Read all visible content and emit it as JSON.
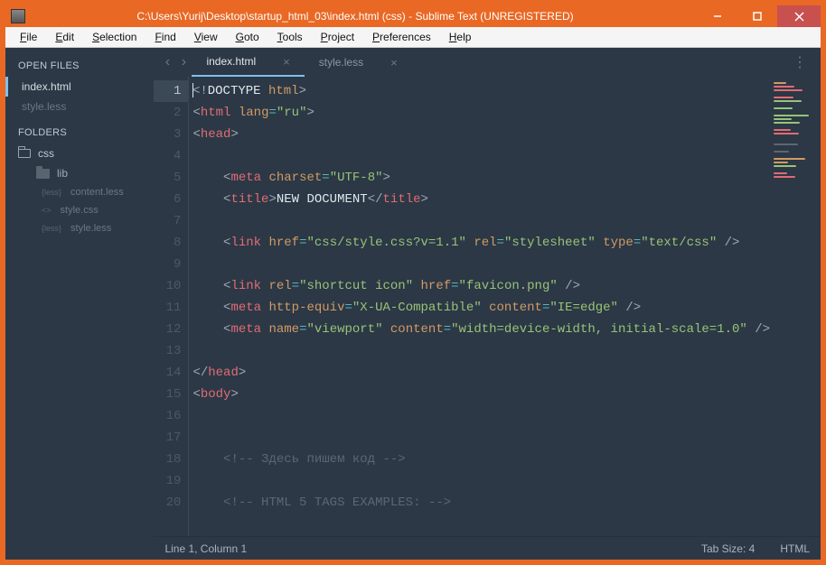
{
  "window": {
    "title": "C:\\Users\\Yurij\\Desktop\\startup_html_03\\index.html (css) - Sublime Text (UNREGISTERED)"
  },
  "menu": [
    "File",
    "Edit",
    "Selection",
    "Find",
    "View",
    "Goto",
    "Tools",
    "Project",
    "Preferences",
    "Help"
  ],
  "sidebar": {
    "openFilesHeader": "OPEN FILES",
    "openFiles": [
      {
        "label": "index.html",
        "active": true
      },
      {
        "label": "style.less",
        "active": false
      }
    ],
    "foldersHeader": "FOLDERS",
    "rootFolder": "css",
    "subFolder": "lib",
    "subFiles": [
      {
        "prefix": "{less}",
        "label": "content.less"
      },
      {
        "prefix": "<>",
        "label": "style.css"
      },
      {
        "prefix": "{less}",
        "label": "style.less"
      }
    ]
  },
  "tabs": [
    {
      "label": "index.html",
      "active": true
    },
    {
      "label": "style.less",
      "active": false
    }
  ],
  "code": {
    "lines": [
      {
        "n": 1,
        "active": true,
        "tokens": [
          {
            "t": "caret"
          },
          {
            "t": "brk",
            "s": "<!"
          },
          {
            "t": "sp",
            "s": "DOCTYPE "
          },
          {
            "t": "attr",
            "s": "html"
          },
          {
            "t": "brk",
            "s": ">"
          }
        ]
      },
      {
        "n": 2,
        "tokens": [
          {
            "t": "brk",
            "s": "<"
          },
          {
            "t": "tag",
            "s": "html"
          },
          {
            "t": "sp",
            "s": " "
          },
          {
            "t": "attr",
            "s": "lang"
          },
          {
            "t": "op",
            "s": "="
          },
          {
            "t": "str",
            "s": "\"ru\""
          },
          {
            "t": "brk",
            "s": ">"
          }
        ]
      },
      {
        "n": 3,
        "tokens": [
          {
            "t": "brk",
            "s": "<"
          },
          {
            "t": "tag",
            "s": "head"
          },
          {
            "t": "brk",
            "s": ">"
          }
        ]
      },
      {
        "n": 4,
        "tokens": []
      },
      {
        "n": 5,
        "tokens": [
          {
            "t": "sp",
            "s": "    "
          },
          {
            "t": "brk",
            "s": "<"
          },
          {
            "t": "tag",
            "s": "meta"
          },
          {
            "t": "sp",
            "s": " "
          },
          {
            "t": "attr",
            "s": "charset"
          },
          {
            "t": "op",
            "s": "="
          },
          {
            "t": "str",
            "s": "\"UTF-8\""
          },
          {
            "t": "brk",
            "s": ">"
          }
        ]
      },
      {
        "n": 6,
        "tokens": [
          {
            "t": "sp",
            "s": "    "
          },
          {
            "t": "brk",
            "s": "<"
          },
          {
            "t": "tag",
            "s": "title"
          },
          {
            "t": "brk",
            "s": ">"
          },
          {
            "t": "txt",
            "s": "NEW DOCUMENT"
          },
          {
            "t": "brk",
            "s": "</"
          },
          {
            "t": "tag",
            "s": "title"
          },
          {
            "t": "brk",
            "s": ">"
          }
        ]
      },
      {
        "n": 7,
        "tokens": []
      },
      {
        "n": 8,
        "tokens": [
          {
            "t": "sp",
            "s": "    "
          },
          {
            "t": "brk",
            "s": "<"
          },
          {
            "t": "tag",
            "s": "link"
          },
          {
            "t": "sp",
            "s": " "
          },
          {
            "t": "attr",
            "s": "href"
          },
          {
            "t": "op",
            "s": "="
          },
          {
            "t": "str",
            "s": "\"css/style.css?v=1.1\""
          },
          {
            "t": "sp",
            "s": " "
          },
          {
            "t": "attr",
            "s": "rel"
          },
          {
            "t": "op",
            "s": "="
          },
          {
            "t": "str",
            "s": "\"stylesheet\""
          },
          {
            "t": "sp",
            "s": " "
          },
          {
            "t": "attr",
            "s": "type"
          },
          {
            "t": "op",
            "s": "="
          },
          {
            "t": "str",
            "s": "\"text/css\""
          },
          {
            "t": "sp",
            "s": " "
          },
          {
            "t": "brk",
            "s": "/>"
          }
        ]
      },
      {
        "n": 9,
        "tokens": []
      },
      {
        "n": 10,
        "tokens": [
          {
            "t": "sp",
            "s": "    "
          },
          {
            "t": "brk",
            "s": "<"
          },
          {
            "t": "tag",
            "s": "link"
          },
          {
            "t": "sp",
            "s": " "
          },
          {
            "t": "attr",
            "s": "rel"
          },
          {
            "t": "op",
            "s": "="
          },
          {
            "t": "str",
            "s": "\"shortcut icon\""
          },
          {
            "t": "sp",
            "s": " "
          },
          {
            "t": "attr",
            "s": "href"
          },
          {
            "t": "op",
            "s": "="
          },
          {
            "t": "str",
            "s": "\"favicon.png\""
          },
          {
            "t": "sp",
            "s": " "
          },
          {
            "t": "brk",
            "s": "/>"
          }
        ]
      },
      {
        "n": 11,
        "tokens": [
          {
            "t": "sp",
            "s": "    "
          },
          {
            "t": "brk",
            "s": "<"
          },
          {
            "t": "tag",
            "s": "meta"
          },
          {
            "t": "sp",
            "s": " "
          },
          {
            "t": "attr",
            "s": "http-equiv"
          },
          {
            "t": "op",
            "s": "="
          },
          {
            "t": "str",
            "s": "\"X-UA-Compatible\""
          },
          {
            "t": "sp",
            "s": " "
          },
          {
            "t": "attr",
            "s": "content"
          },
          {
            "t": "op",
            "s": "="
          },
          {
            "t": "str",
            "s": "\"IE=edge\""
          },
          {
            "t": "sp",
            "s": " "
          },
          {
            "t": "brk",
            "s": "/>"
          }
        ]
      },
      {
        "n": 12,
        "tokens": [
          {
            "t": "sp",
            "s": "    "
          },
          {
            "t": "brk",
            "s": "<"
          },
          {
            "t": "tag",
            "s": "meta"
          },
          {
            "t": "sp",
            "s": " "
          },
          {
            "t": "attr",
            "s": "name"
          },
          {
            "t": "op",
            "s": "="
          },
          {
            "t": "str",
            "s": "\"viewport\""
          },
          {
            "t": "sp",
            "s": " "
          },
          {
            "t": "attr",
            "s": "content"
          },
          {
            "t": "op",
            "s": "="
          },
          {
            "t": "str",
            "s": "\"width=device-width, initial-scale=1.0\""
          },
          {
            "t": "sp",
            "s": " "
          },
          {
            "t": "brk",
            "s": "/>"
          }
        ]
      },
      {
        "n": 13,
        "tokens": []
      },
      {
        "n": 14,
        "tokens": [
          {
            "t": "brk",
            "s": "</"
          },
          {
            "t": "tag",
            "s": "head"
          },
          {
            "t": "brk",
            "s": ">"
          }
        ]
      },
      {
        "n": 15,
        "tokens": [
          {
            "t": "brk",
            "s": "<"
          },
          {
            "t": "tag",
            "s": "body"
          },
          {
            "t": "brk",
            "s": ">"
          }
        ]
      },
      {
        "n": 16,
        "tokens": []
      },
      {
        "n": 17,
        "tokens": []
      },
      {
        "n": 18,
        "tokens": [
          {
            "t": "sp",
            "s": "    "
          },
          {
            "t": "cmt",
            "s": "<!-- Здесь пишем код -->"
          }
        ]
      },
      {
        "n": 19,
        "tokens": []
      },
      {
        "n": 20,
        "tokens": [
          {
            "t": "sp",
            "s": "    "
          },
          {
            "t": "cmt",
            "s": "<!-- HTML 5 TAGS EXAMPLES: -->"
          }
        ]
      }
    ]
  },
  "status": {
    "left": "Line 1, Column 1",
    "tabsize": "Tab Size: 4",
    "syntax": "HTML"
  }
}
